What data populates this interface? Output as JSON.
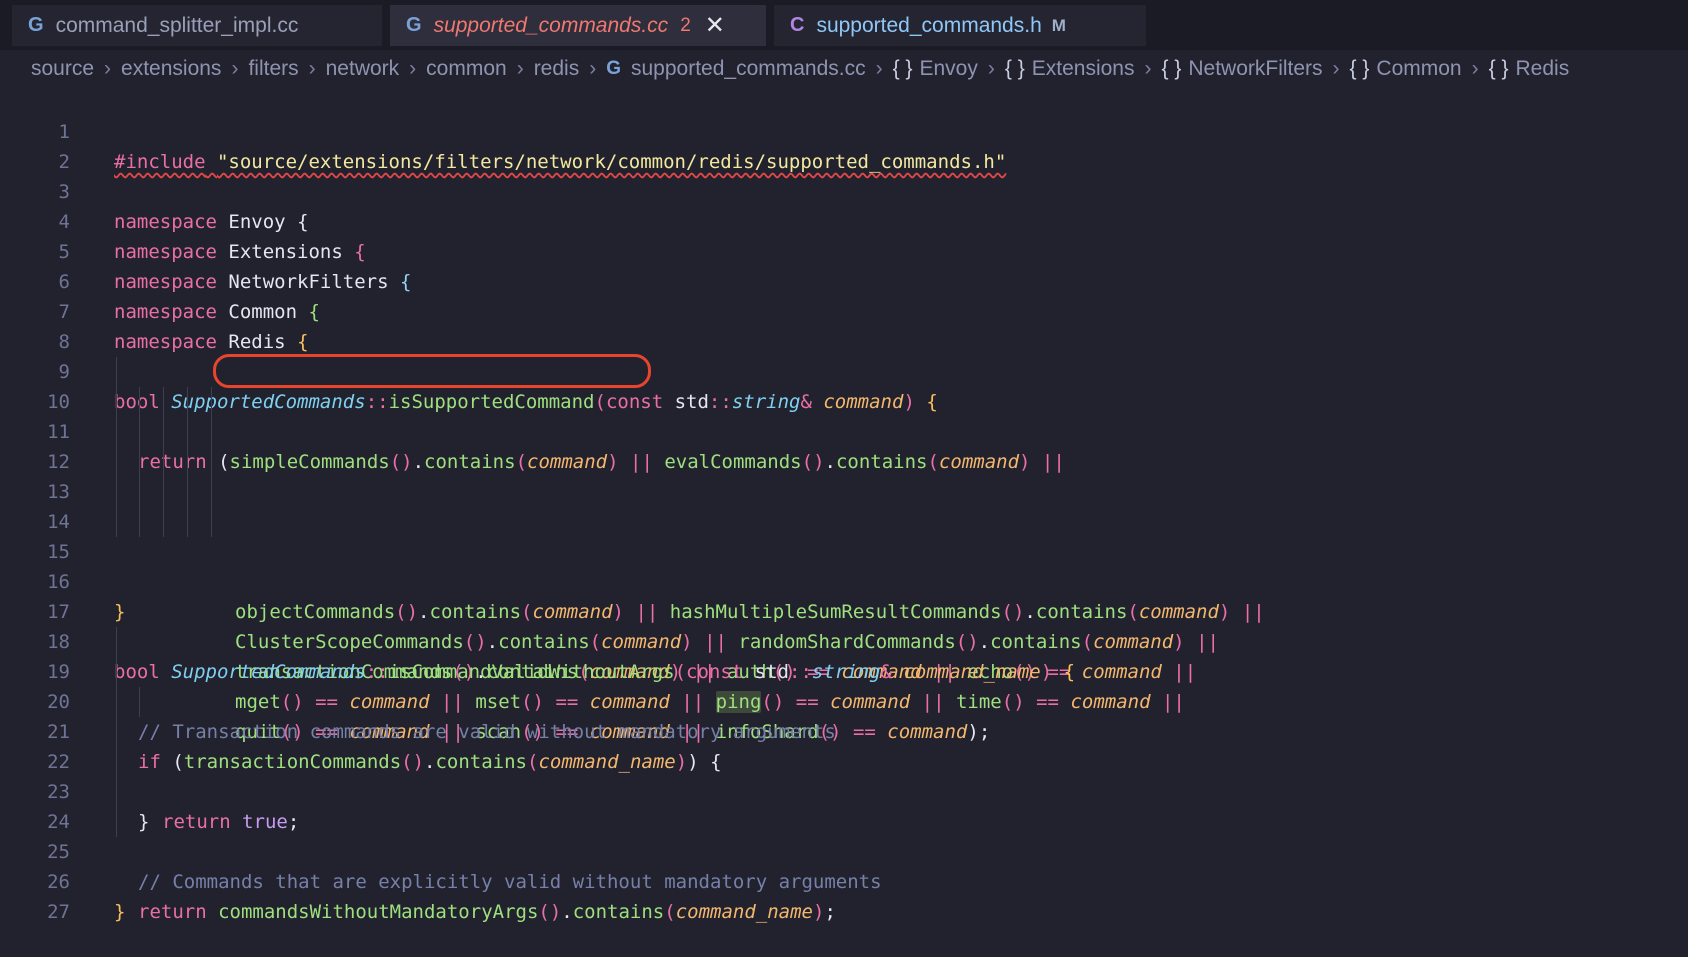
{
  "tabs": [
    {
      "icon": "G",
      "label": "command_splitter_impl.cc"
    },
    {
      "icon": "G",
      "label": "supported_commands.cc",
      "problems": "2",
      "close": "✕"
    },
    {
      "icon": "C",
      "label": "supported_commands.h",
      "status": "M"
    }
  ],
  "breadcrumb": {
    "folders": [
      "source",
      "extensions",
      "filters",
      "network",
      "common",
      "redis"
    ],
    "file_icon": "G",
    "file": "supported_commands.cc",
    "symbols": [
      "Envoy",
      "Extensions",
      "NetworkFilters",
      "Common",
      "Redis"
    ],
    "symbol_icon": "{ }",
    "separator": "›"
  },
  "code": {
    "line_numbers": [
      "1",
      "2",
      "3",
      "4",
      "5",
      "6",
      "7",
      "8",
      "9",
      "10",
      "11",
      "12",
      "13",
      "14",
      "15",
      "16",
      "17",
      "18",
      "19",
      "20",
      "21",
      "22",
      "23",
      "24",
      "25",
      "26",
      "27"
    ],
    "include_directive": "#include",
    "include_path": "\"source/extensions/filters/network/common/redis/supported_commands.h\"",
    "ns_keyword": "namespace",
    "namespaces": [
      "Envoy",
      "Extensions",
      "NetworkFilters",
      "Common",
      "Redis"
    ],
    "kw_bool": "bool",
    "kw_return": "return",
    "kw_if": "if",
    "kw_const": "const",
    "kw_true": "true",
    "class_name": "SupportedCommands",
    "scope": "::",
    "std": "std",
    "type_string": "string",
    "amp": "&",
    "fn_is_supported": "isSupportedCommand",
    "fn_valid_without_args": "isCommandValidWithoutArgs",
    "param_command": "command",
    "param_command_name": "command_name",
    "contains": "contains",
    "or": "||",
    "eq": "==",
    "f_simple": "simpleCommands",
    "f_eval": "evalCommands",
    "f_object": "objectCommands",
    "f_hash": "hashMultipleSumResultCommands",
    "f_cluster": "ClusterScopeCommands",
    "f_random": "randomShardCommands",
    "f_transaction": "transactionCommands",
    "f_auth": "auth",
    "f_echo": "echo",
    "f_mget": "mget",
    "f_mset": "mset",
    "f_ping": "ping",
    "f_time": "time",
    "f_quit": "quit",
    "f_scan": "scan",
    "f_infoshard": "infoShard",
    "f_without_args": "commandsWithoutMandatoryArgs",
    "comment_1": "// Transaction commands are valid without mandatory arguments",
    "comment_2": "// Commands that are explicitly valid without mandatory arguments"
  },
  "colors": {
    "background": "#22222e",
    "keyword": "#ea6fa6",
    "function": "#9ee07e",
    "parameter": "#f4b76e",
    "annotation_circle": "#e8452f"
  }
}
